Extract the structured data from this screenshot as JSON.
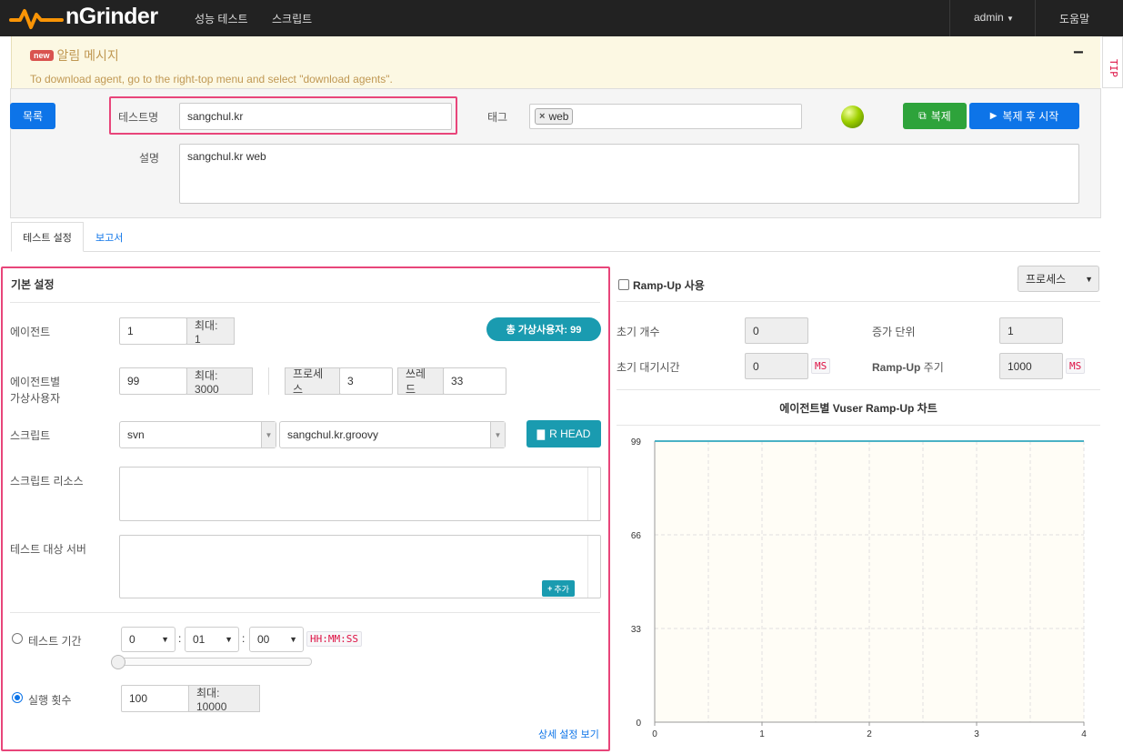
{
  "navbar": {
    "logo": "nGrinder",
    "menu": [
      "성능 테스트",
      "스크립트"
    ],
    "user": "admin",
    "help": "도움말"
  },
  "alert": {
    "badge": "new",
    "title": "알림 메시지",
    "message": "To download agent, go to the right-top menu and select \"download agents\".",
    "collapse": "−",
    "tip": "TIP"
  },
  "header": {
    "list_button": "목록",
    "test_name_label": "테스트명",
    "test_name_value": "sangchul.kr",
    "tag_label": "태그",
    "tags": [
      "web"
    ],
    "description_label": "설명",
    "description_value": "sangchul.kr web",
    "clone_button": "복제",
    "clone_start_button": "복제 후 시작",
    "status_color": "#9ed000"
  },
  "tabs": [
    "테스트 설정",
    "보고서"
  ],
  "basic": {
    "title": "기본 설정",
    "agent_label": "에이전트",
    "agent_value": "1",
    "agent_max": "최대: 1",
    "total_vusers": "총 가상사용자: 99",
    "vuser_label_1": "에이전트별",
    "vuser_label_2": "가상사용자",
    "vuser_value": "99",
    "vuser_max": "최대: 3000",
    "process_label": "프로세스",
    "process_value": "3",
    "thread_label": "쓰레드",
    "thread_value": "33",
    "script_label": "스크립트",
    "script_repo": "svn",
    "script_file": "sangchul.kr.groovy",
    "head_button": "R HEAD",
    "resource_label": "스크립트 리소스",
    "target_label": "테스트 대상 서버",
    "add_button": "추가",
    "duration_label": "테스트 기간",
    "duration_hh": "0",
    "duration_mm": "01",
    "duration_ss": "00",
    "duration_unit": "HH:MM:SS",
    "duration_slider_value": 0,
    "run_count_label": "실행 횟수",
    "run_count_value": "100",
    "run_count_max": "최대: 10000",
    "detail_link": "상세 설정 보기",
    "selected_mode": "run_count"
  },
  "rampup": {
    "enable_label": "Ramp-Up 사용",
    "enabled": false,
    "type_select": "프로세스",
    "init_count_label": "초기 개수",
    "init_count_value": "0",
    "increment_label": "증가 단위",
    "increment_value": "1",
    "init_sleep_label": "초기 대기시간",
    "init_sleep_value": "0",
    "init_sleep_unit": "MS",
    "interval_label_bold": "Ramp-Up",
    "interval_label_rest": " 주기",
    "interval_value": "1000",
    "interval_unit": "MS",
    "chart_title": "에이전트별 Vuser Ramp-Up 차트"
  },
  "chart_data": {
    "type": "line",
    "title": "에이전트별 Vuser Ramp-Up 차트",
    "x": [
      0,
      1,
      2,
      3,
      4
    ],
    "series": [
      {
        "values": [
          99,
          99,
          99,
          99,
          99
        ]
      }
    ],
    "xticks": [
      "0",
      "1",
      "2",
      "3",
      "4"
    ],
    "yticks": [
      "0",
      "33",
      "66",
      "99"
    ],
    "xlim": [
      0,
      4
    ],
    "ylim": [
      0,
      99
    ],
    "line_color": "#4bb2c5",
    "grid": true
  }
}
